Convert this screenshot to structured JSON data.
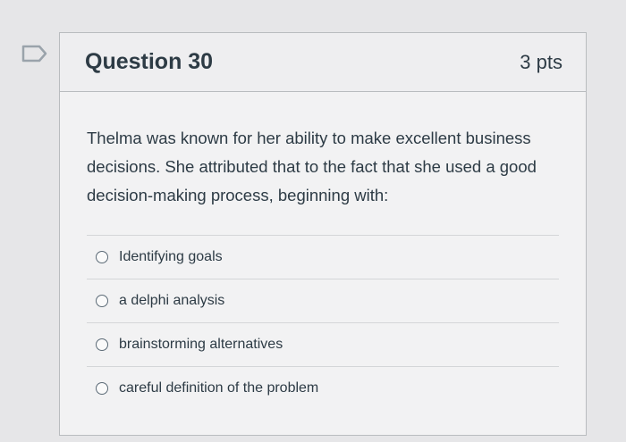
{
  "question": {
    "title": "Question 30",
    "points": "3 pts",
    "text": "Thelma was known for her ability to make excellent business decisions. She attributed that to the fact that she used a good decision-making process, beginning with:",
    "answers": [
      {
        "label": "Identifying goals"
      },
      {
        "label": "a delphi analysis"
      },
      {
        "label": "brainstorming alternatives"
      },
      {
        "label": "careful definition of the problem"
      }
    ]
  },
  "icons": {
    "flag": "bookmark-flag-icon"
  },
  "colors": {
    "text": "#2d3b45",
    "border": "#b9bcbf"
  }
}
